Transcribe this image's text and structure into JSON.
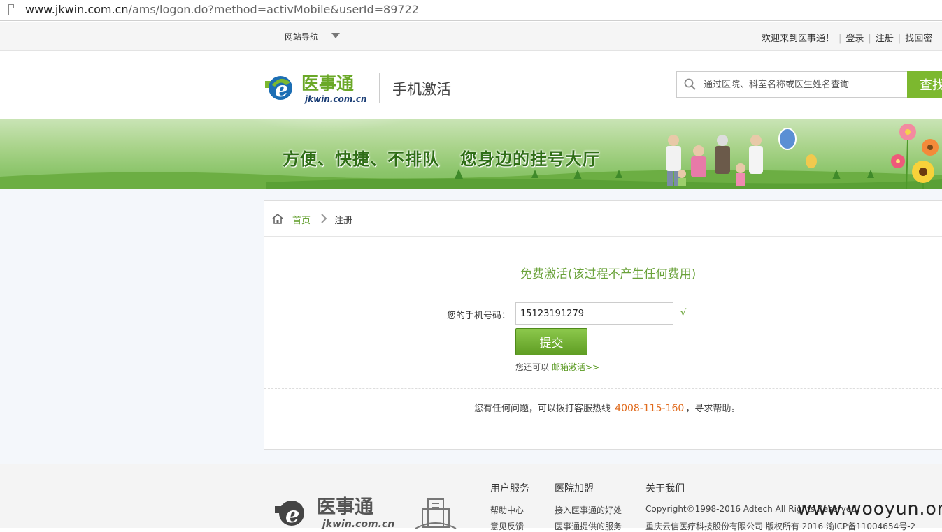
{
  "browser": {
    "url_host": "www.jkwin.com.cn",
    "url_path": "/ams/logon.do?method=activMobile&userId=89722"
  },
  "topnav": {
    "site_nav_label": "网站导航",
    "welcome": "欢迎来到医事通！",
    "login": "登录",
    "register": "注册",
    "find": "找回密"
  },
  "header": {
    "logo_cn": "医事通",
    "logo_domain": "jkwin.com.cn",
    "page_tag": "手机激活",
    "search_placeholder": "通过医院、科室名称或医生姓名查询",
    "search_button": "查找"
  },
  "banner": {
    "slogan_left": "方便、快捷、不排队",
    "slogan_right": "您身边的挂号大厅"
  },
  "breadcrumb": {
    "home": "首页",
    "current": "注册"
  },
  "form": {
    "title": "免费激活(该过程不产生任何费用)",
    "phone_label": "您的手机号码：",
    "phone_value": "15123191279",
    "valid_mark": "√",
    "submit_label": "提交",
    "alt_prefix": "您还可以",
    "alt_link": "邮箱激活>>"
  },
  "help": {
    "prefix": "您有任何问题，可以拨打客服热线",
    "hotline": "4008-115-160",
    "suffix": "，寻求帮助。"
  },
  "footer": {
    "logo_cn": "医事通",
    "logo_domain": "jkwin.com.cn",
    "user_service": {
      "title": "用户服务",
      "links": [
        "帮助中心",
        "意见反馈"
      ]
    },
    "hospital_join": {
      "title": "医院加盟",
      "links": [
        "接入医事通的好处",
        "医事通提供的服务"
      ]
    },
    "about": {
      "title": "关于我们",
      "copyright": "Copyright©1998-2016 Adtech All Rights Reserved",
      "company": "重庆云信医疗科技股份有限公司 版权所有 2016 渝ICP备11004654号-2"
    },
    "watermark": "www.wooyun.org"
  },
  "colors": {
    "brand_green": "#7cb82f",
    "link_green": "#5a9a22",
    "hotline_orange": "#e06a1c"
  }
}
